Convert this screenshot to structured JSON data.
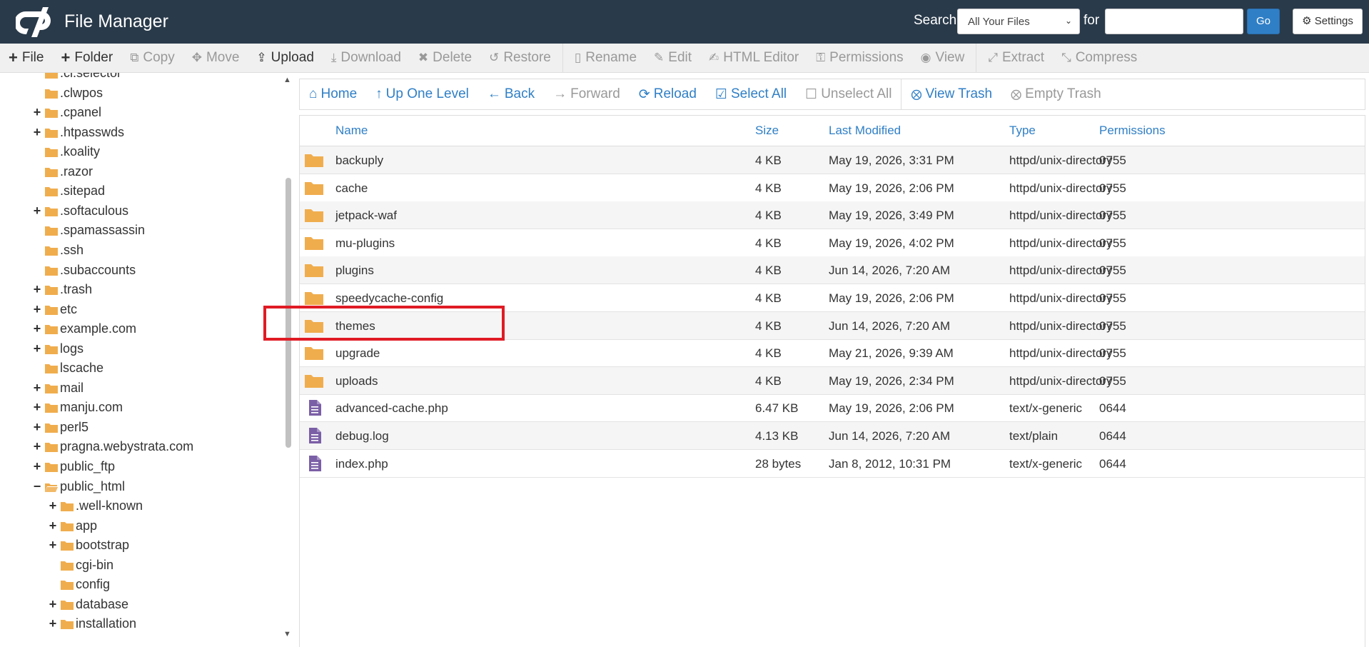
{
  "header": {
    "title": "File Manager",
    "search_label": "Search",
    "search_scope": "All Your Files",
    "for_label": "for",
    "search_value": "",
    "go_label": "Go",
    "settings_label": "Settings"
  },
  "toolbar": [
    {
      "label": "File",
      "icon": "plus",
      "glyph": "+",
      "active": true
    },
    {
      "label": "Folder",
      "icon": "plus",
      "glyph": "+",
      "active": true
    },
    {
      "label": "Copy",
      "icon": "copy",
      "glyph": "⧉",
      "active": false
    },
    {
      "label": "Move",
      "icon": "move",
      "glyph": "✥",
      "active": false
    },
    {
      "label": "Upload",
      "icon": "upload",
      "glyph": "⇪",
      "active": true
    },
    {
      "label": "Download",
      "icon": "download",
      "glyph": "⤓",
      "active": false
    },
    {
      "label": "Delete",
      "icon": "delete",
      "glyph": "✖",
      "active": false
    },
    {
      "label": "Restore",
      "icon": "restore",
      "glyph": "↺",
      "active": false
    },
    {
      "label": "Rename",
      "icon": "rename",
      "glyph": "▯",
      "active": false,
      "sep_before": true
    },
    {
      "label": "Edit",
      "icon": "pencil",
      "glyph": "✎",
      "active": false
    },
    {
      "label": "HTML Editor",
      "icon": "html-editor",
      "glyph": "✍",
      "active": false
    },
    {
      "label": "Permissions",
      "icon": "key",
      "glyph": "⚿",
      "active": false
    },
    {
      "label": "View",
      "icon": "eye",
      "glyph": "◉",
      "active": false
    },
    {
      "label": "Extract",
      "icon": "extract",
      "glyph": "⤢",
      "active": false,
      "sep_before": true
    },
    {
      "label": "Compress",
      "icon": "compress",
      "glyph": "⤡",
      "active": false
    }
  ],
  "tree": [
    {
      "label": ".cl.selector",
      "level": 0,
      "expand": "",
      "open": false
    },
    {
      "label": ".clwpos",
      "level": 0,
      "expand": "",
      "open": false
    },
    {
      "label": ".cpanel",
      "level": 0,
      "expand": "+",
      "open": false
    },
    {
      "label": ".htpasswds",
      "level": 0,
      "expand": "+",
      "open": false
    },
    {
      "label": ".koality",
      "level": 0,
      "expand": "",
      "open": false
    },
    {
      "label": ".razor",
      "level": 0,
      "expand": "",
      "open": false
    },
    {
      "label": ".sitepad",
      "level": 0,
      "expand": "",
      "open": false
    },
    {
      "label": ".softaculous",
      "level": 0,
      "expand": "+",
      "open": false
    },
    {
      "label": ".spamassassin",
      "level": 0,
      "expand": "",
      "open": false
    },
    {
      "label": ".ssh",
      "level": 0,
      "expand": "",
      "open": false
    },
    {
      "label": ".subaccounts",
      "level": 0,
      "expand": "",
      "open": false
    },
    {
      "label": ".trash",
      "level": 0,
      "expand": "+",
      "open": false
    },
    {
      "label": "etc",
      "level": 0,
      "expand": "+",
      "open": false
    },
    {
      "label": "example.com",
      "level": 0,
      "expand": "+",
      "open": false
    },
    {
      "label": "logs",
      "level": 0,
      "expand": "+",
      "open": false
    },
    {
      "label": "lscache",
      "level": 0,
      "expand": "",
      "open": false
    },
    {
      "label": "mail",
      "level": 0,
      "expand": "+",
      "open": false
    },
    {
      "label": "manju.com",
      "level": 0,
      "expand": "+",
      "open": false
    },
    {
      "label": "perl5",
      "level": 0,
      "expand": "+",
      "open": false
    },
    {
      "label": "pragna.webystrata.com",
      "level": 0,
      "expand": "+",
      "open": false
    },
    {
      "label": "public_ftp",
      "level": 0,
      "expand": "+",
      "open": false
    },
    {
      "label": "public_html",
      "level": 0,
      "expand": "−",
      "open": true
    },
    {
      "label": ".well-known",
      "level": 1,
      "expand": "+",
      "open": false
    },
    {
      "label": "app",
      "level": 1,
      "expand": "+",
      "open": false
    },
    {
      "label": "bootstrap",
      "level": 1,
      "expand": "+",
      "open": false
    },
    {
      "label": "cgi-bin",
      "level": 1,
      "expand": "",
      "open": false
    },
    {
      "label": "config",
      "level": 1,
      "expand": "",
      "open": false
    },
    {
      "label": "database",
      "level": 1,
      "expand": "+",
      "open": false
    },
    {
      "label": "installation",
      "level": 1,
      "expand": "+",
      "open": false
    }
  ],
  "navbar": [
    {
      "label": "Home",
      "icon": "home",
      "glyph": "⌂",
      "enabled": true
    },
    {
      "label": "Up One Level",
      "icon": "arrow-up",
      "glyph": "↑",
      "enabled": true
    },
    {
      "label": "Back",
      "icon": "arrow-left",
      "glyph": "←",
      "enabled": true
    },
    {
      "label": "Forward",
      "icon": "arrow-right",
      "glyph": "→",
      "enabled": false
    },
    {
      "label": "Reload",
      "icon": "reload",
      "glyph": "⟳",
      "enabled": true
    },
    {
      "label": "Select All",
      "icon": "checkbox-checked",
      "glyph": "☑",
      "enabled": true
    },
    {
      "label": "Unselect All",
      "icon": "checkbox-empty",
      "glyph": "☐",
      "enabled": false
    },
    {
      "label": "View Trash",
      "icon": "trash",
      "glyph": "🗑",
      "enabled": true,
      "sep_before": true
    },
    {
      "label": "Empty Trash",
      "icon": "trash",
      "glyph": "🗑",
      "enabled": false
    }
  ],
  "table": {
    "columns": [
      "Name",
      "Size",
      "Last Modified",
      "Type",
      "Permissions"
    ],
    "rows": [
      {
        "name": "backuply",
        "size": "4 KB",
        "modified": "May 19, 2026, 3:31 PM",
        "type": "httpd/unix-directory",
        "perms": "0755",
        "kind": "folder"
      },
      {
        "name": "cache",
        "size": "4 KB",
        "modified": "May 19, 2026, 2:06 PM",
        "type": "httpd/unix-directory",
        "perms": "0755",
        "kind": "folder"
      },
      {
        "name": "jetpack-waf",
        "size": "4 KB",
        "modified": "May 19, 2026, 3:49 PM",
        "type": "httpd/unix-directory",
        "perms": "0755",
        "kind": "folder"
      },
      {
        "name": "mu-plugins",
        "size": "4 KB",
        "modified": "May 19, 2026, 4:02 PM",
        "type": "httpd/unix-directory",
        "perms": "0755",
        "kind": "folder"
      },
      {
        "name": "plugins",
        "size": "4 KB",
        "modified": "Jun 14, 2026, 7:20 AM",
        "type": "httpd/unix-directory",
        "perms": "0755",
        "kind": "folder"
      },
      {
        "name": "speedycache-config",
        "size": "4 KB",
        "modified": "May 19, 2026, 2:06 PM",
        "type": "httpd/unix-directory",
        "perms": "0755",
        "kind": "folder"
      },
      {
        "name": "themes",
        "size": "4 KB",
        "modified": "Jun 14, 2026, 7:20 AM",
        "type": "httpd/unix-directory",
        "perms": "0755",
        "kind": "folder"
      },
      {
        "name": "upgrade",
        "size": "4 KB",
        "modified": "May 21, 2026, 9:39 AM",
        "type": "httpd/unix-directory",
        "perms": "0755",
        "kind": "folder"
      },
      {
        "name": "uploads",
        "size": "4 KB",
        "modified": "May 19, 2026, 2:34 PM",
        "type": "httpd/unix-directory",
        "perms": "0755",
        "kind": "folder"
      },
      {
        "name": "advanced-cache.php",
        "size": "6.47 KB",
        "modified": "May 19, 2026, 2:06 PM",
        "type": "text/x-generic",
        "perms": "0644",
        "kind": "file"
      },
      {
        "name": "debug.log",
        "size": "4.13 KB",
        "modified": "Jun 14, 2026, 7:20 AM",
        "type": "text/plain",
        "perms": "0644",
        "kind": "file"
      },
      {
        "name": "index.php",
        "size": "28 bytes",
        "modified": "Jan 8, 2012, 10:31 PM",
        "type": "text/x-generic",
        "perms": "0644",
        "kind": "file"
      }
    ]
  },
  "colors": {
    "header_bg": "#293a4a",
    "link_blue": "#2f7fc6",
    "folder_yellow": "#f0ad4e",
    "file_purple": "#7b5fa6",
    "highlight_red": "#e01b24"
  }
}
